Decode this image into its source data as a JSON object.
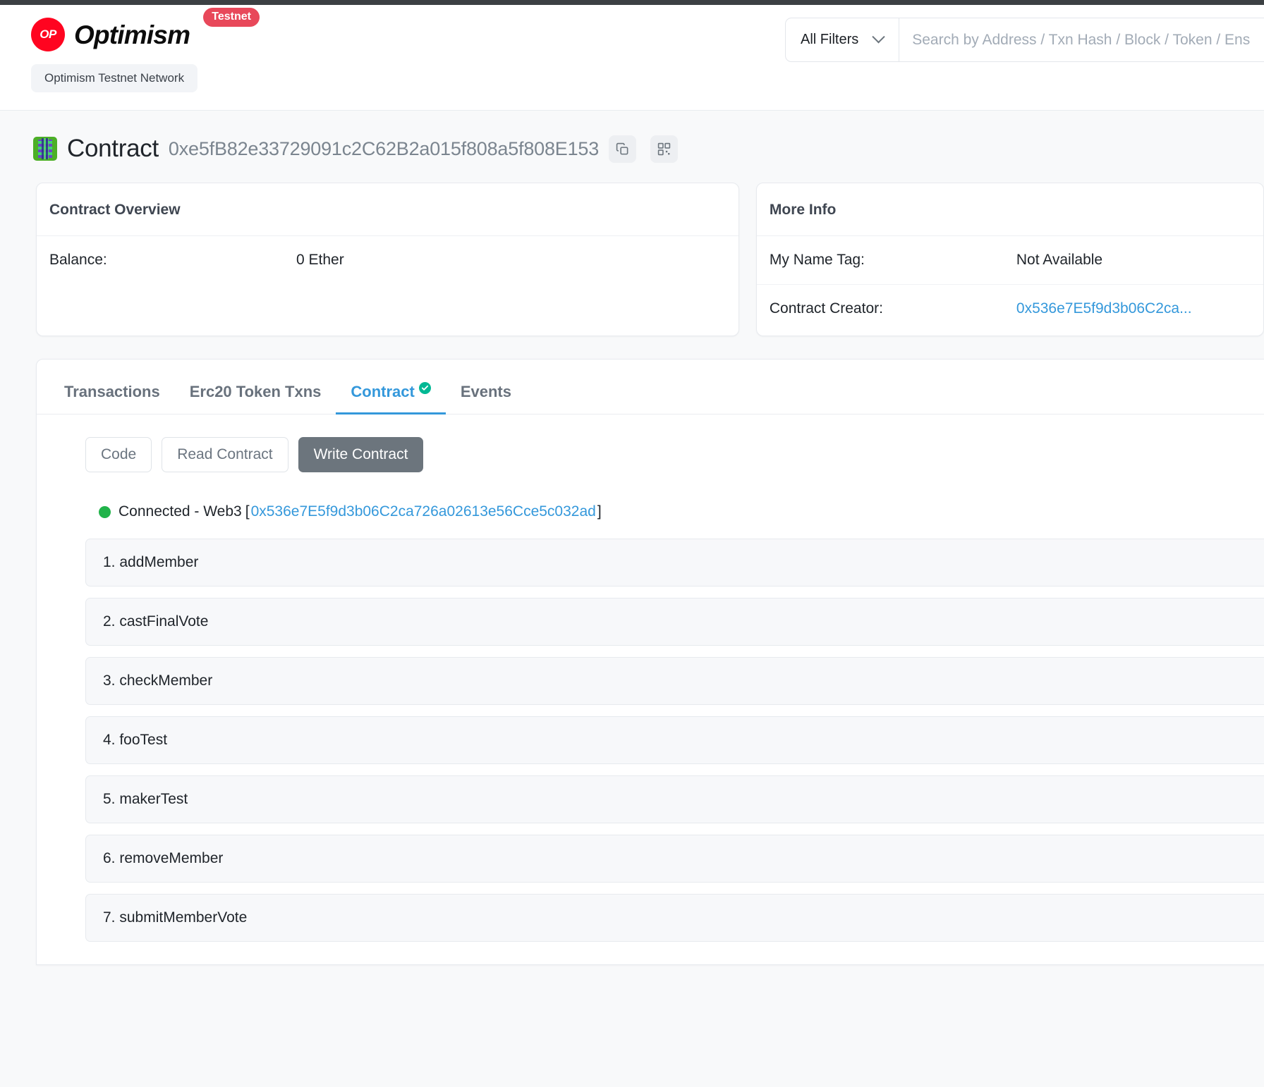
{
  "header": {
    "brand_name": "Optimism",
    "logo_text": "OP",
    "testnet_badge": "Testnet",
    "network_pill": "Optimism Testnet Network",
    "filters_label": "All Filters",
    "search_placeholder": "Search by Address / Txn Hash / Block / Token / Ens"
  },
  "contract": {
    "label": "Contract",
    "address": "0xe5fB82e33729091c2C62B2a015f808a5f808E153"
  },
  "overview": {
    "title": "Contract Overview",
    "balance_label": "Balance:",
    "balance_value": "0 Ether"
  },
  "more_info": {
    "title": "More Info",
    "name_tag_label": "My Name Tag:",
    "name_tag_value": "Not Available",
    "creator_label": "Contract Creator:",
    "creator_value": "0x536e7E5f9d3b06C2ca..."
  },
  "tabs": [
    {
      "label": "Transactions",
      "active": false,
      "verified": false
    },
    {
      "label": "Erc20 Token Txns",
      "active": false,
      "verified": false
    },
    {
      "label": "Contract",
      "active": true,
      "verified": true
    },
    {
      "label": "Events",
      "active": false,
      "verified": false
    }
  ],
  "subtabs": [
    {
      "label": "Code",
      "active": false
    },
    {
      "label": "Read Contract",
      "active": false
    },
    {
      "label": "Write Contract",
      "active": true
    }
  ],
  "connection": {
    "status_text": "Connected - Web3",
    "bracket_open": "[",
    "address": "0x536e7E5f9d3b06C2ca726a02613e56Cce5c032ad",
    "bracket_close": "]"
  },
  "functions": [
    {
      "label": "1. addMember"
    },
    {
      "label": "2. castFinalVote"
    },
    {
      "label": "3. checkMember"
    },
    {
      "label": "4. fooTest"
    },
    {
      "label": "5. makerTest"
    },
    {
      "label": "6. removeMember"
    },
    {
      "label": "7. submitMemberVote"
    }
  ],
  "colors": {
    "brand_red": "#ff0420",
    "link_blue": "#3498db",
    "verified_green": "#00b894",
    "connected_green": "#21b34a",
    "active_subtab": "#6c757d"
  }
}
